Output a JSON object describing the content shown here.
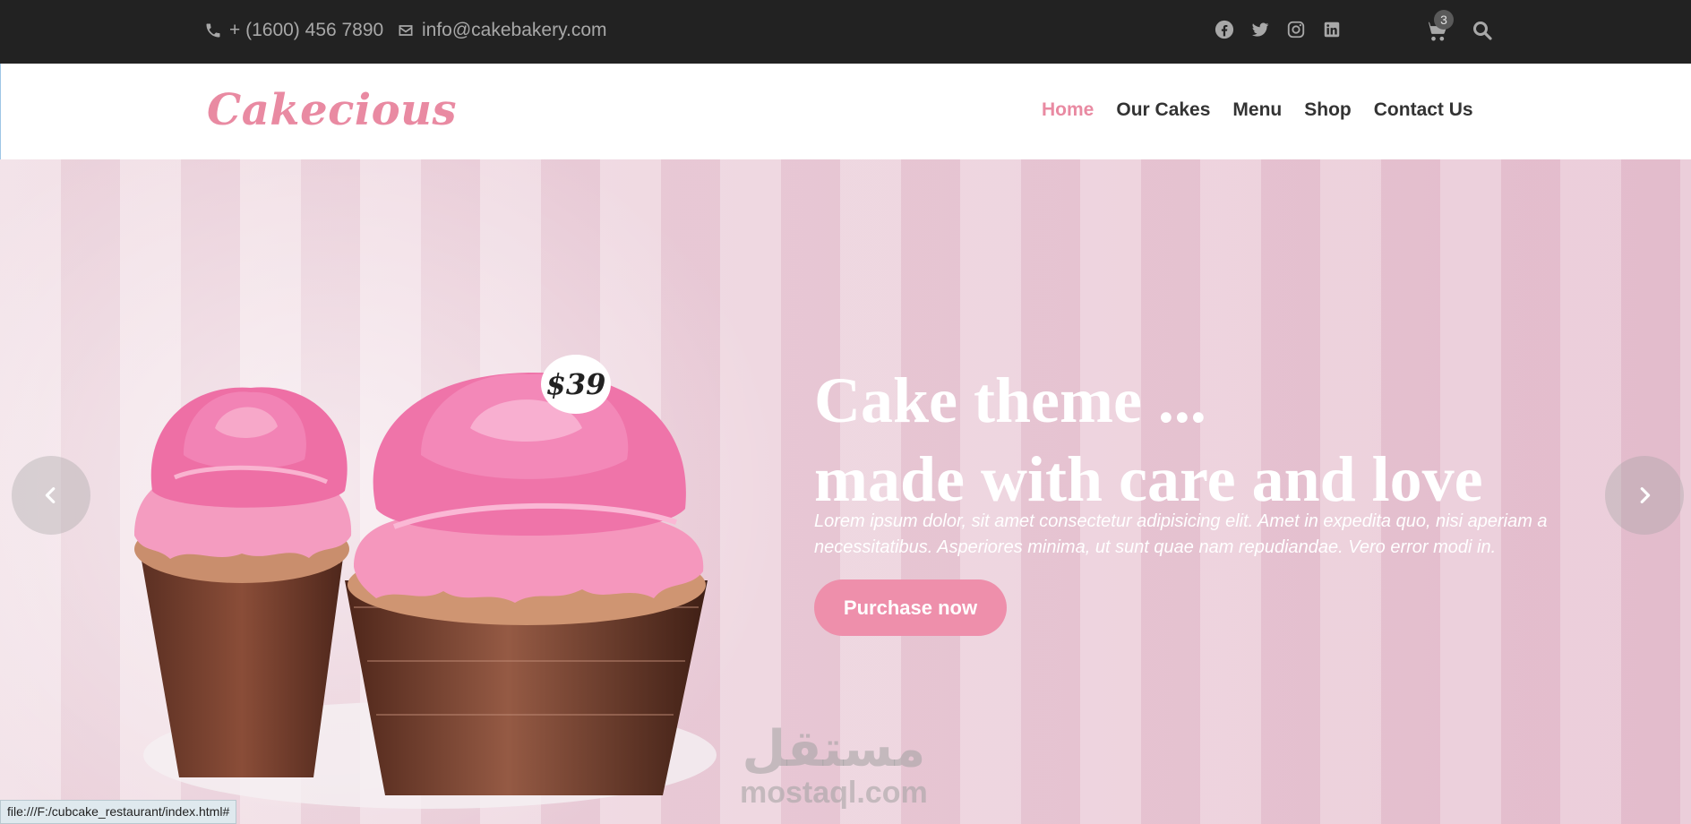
{
  "topbar": {
    "phone": "+ (1600) 456 7890",
    "email": "info@cakebakery.com",
    "social_icons": [
      "facebook-icon",
      "twitter-icon",
      "instagram-icon",
      "linkedin-icon"
    ],
    "cart_count": "3"
  },
  "nav": {
    "logo": "Cakecious",
    "items": [
      {
        "label": "Home",
        "active": true
      },
      {
        "label": "Our Cakes",
        "active": false
      },
      {
        "label": "Menu",
        "active": false
      },
      {
        "label": "Shop",
        "active": false
      },
      {
        "label": "Contact Us",
        "active": false
      }
    ]
  },
  "hero": {
    "price": "$39",
    "title_line1": "Cake theme ...",
    "title_line2": "made with care and love",
    "text": "Lorem ipsum dolor, sit amet consectetur adipisicing elit. Amet in expedita quo, nisi aperiam a necessitatibus. Asperiores minima, ut sunt quae nam repudiandae. Vero error modi in.",
    "cta_label": "Purchase now"
  },
  "watermark": {
    "arabic": "مستقل",
    "latin": "mostaql.com"
  },
  "status_bar": "file:///F:/cubcake_restaurant/index.html#",
  "colors": {
    "accent": "#ee8fab",
    "topbar": "#222222",
    "text": "#333333"
  }
}
